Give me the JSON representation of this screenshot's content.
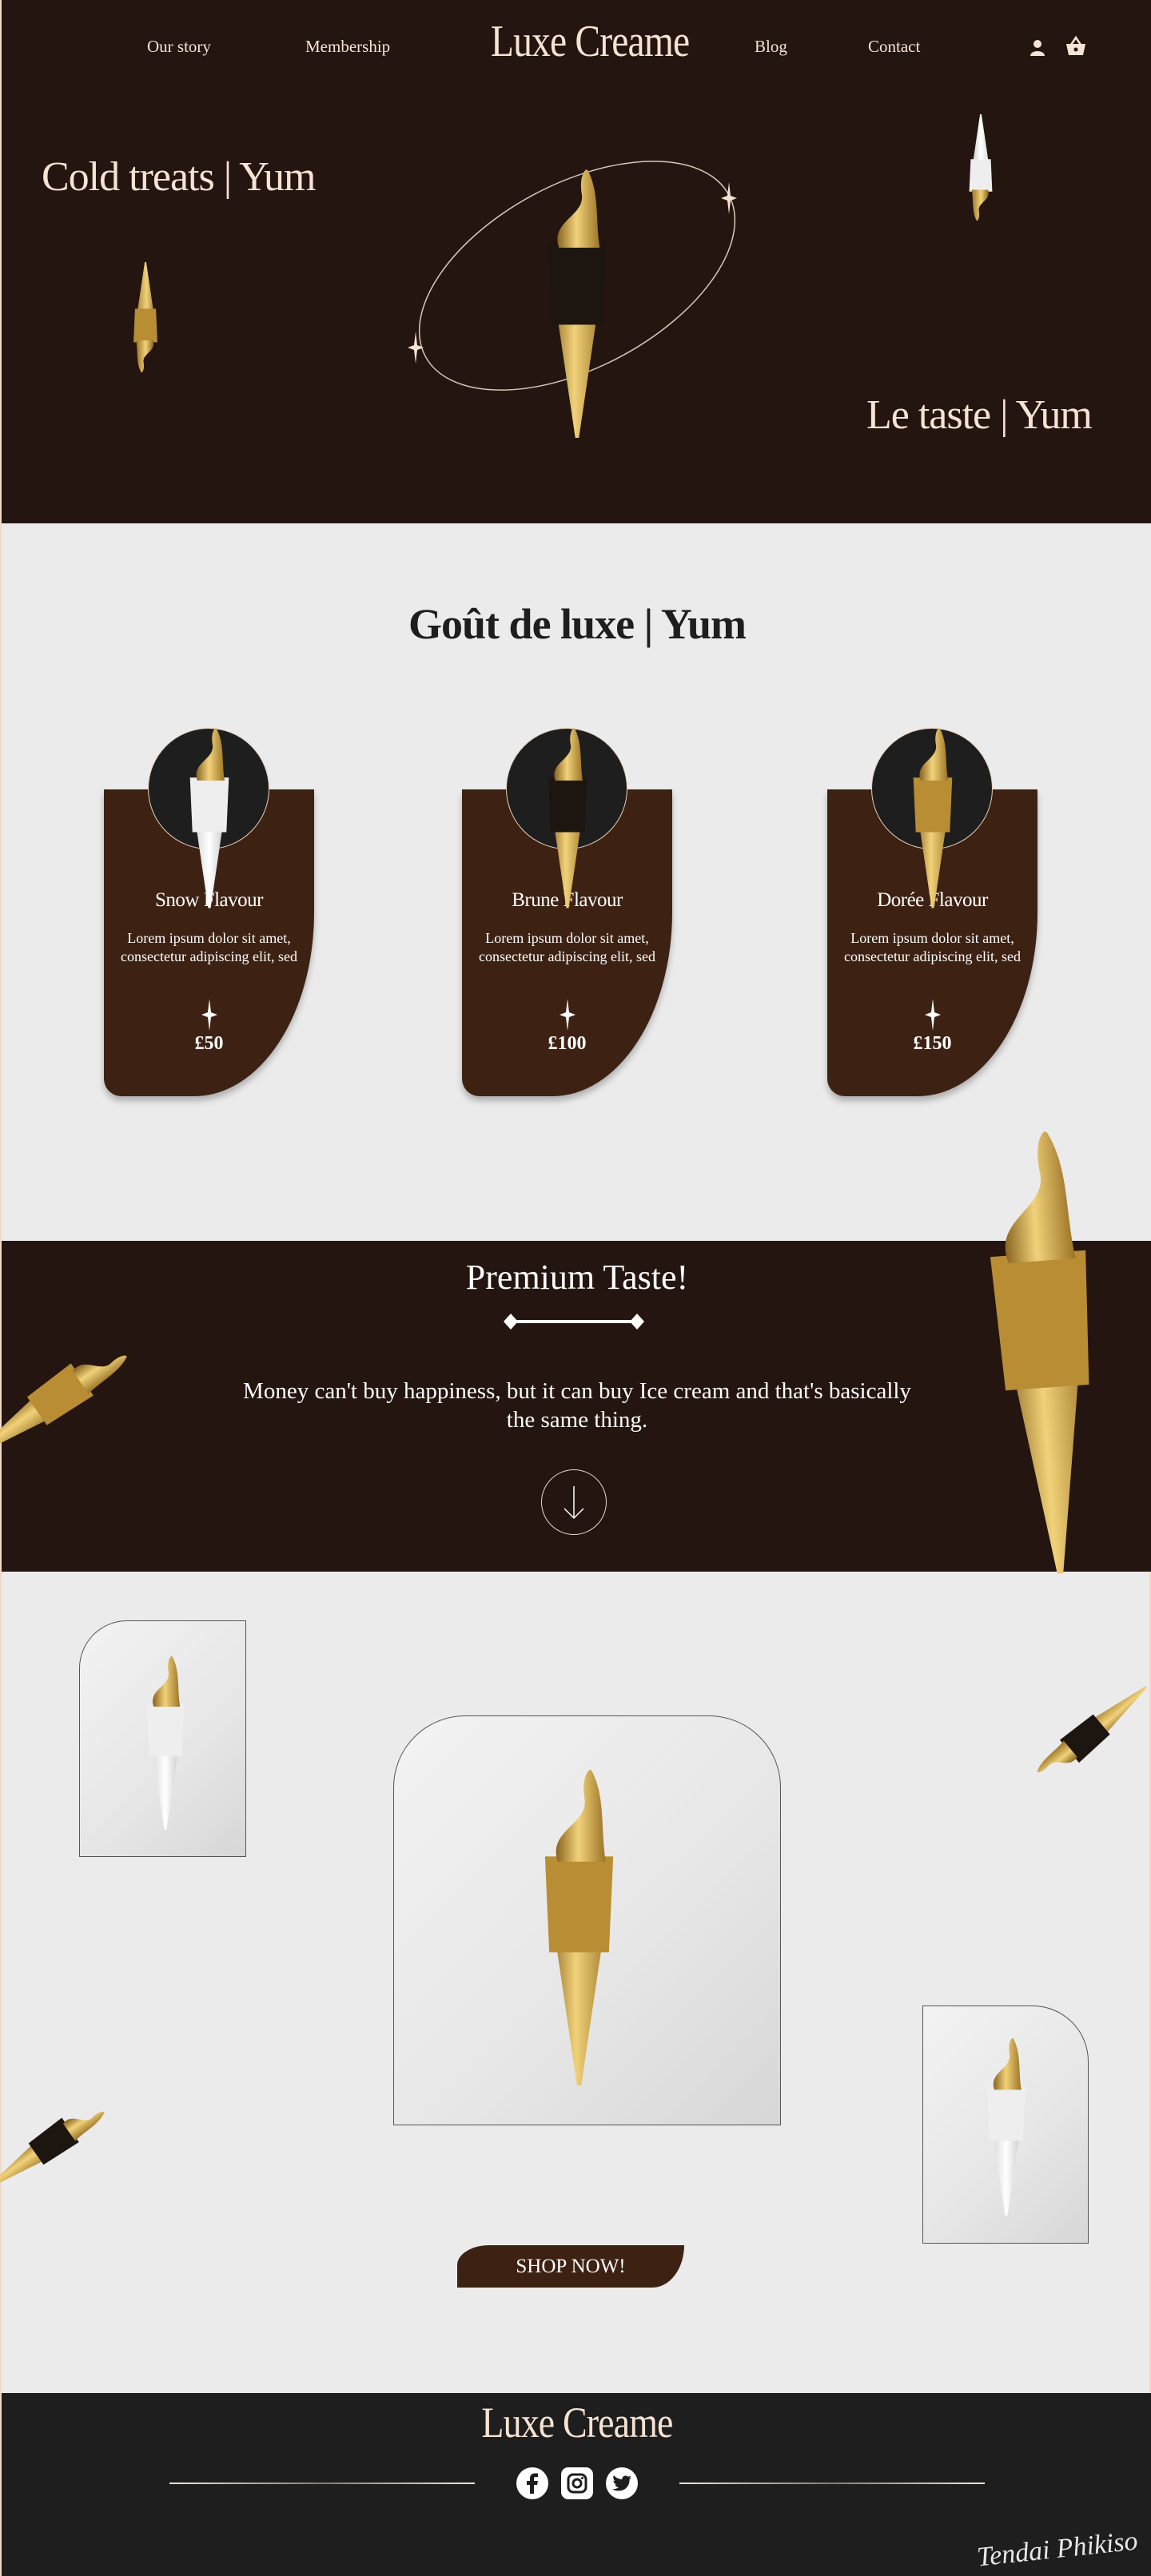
{
  "nav": {
    "items": [
      "Our story",
      "Membership",
      "Blog",
      "Contact"
    ],
    "logo": "Luxe Creame",
    "icons": [
      "user-icon",
      "basket-icon"
    ]
  },
  "hero": {
    "title_left": "Cold treats | Yum",
    "title_right": "Le taste | Yum"
  },
  "flavours": {
    "title": "Goût de luxe | Yum",
    "cards": [
      {
        "name": "Snow Flavour",
        "desc": "Lorem ipsum dolor sit amet, consectetur adipiscing elit, sed",
        "price": "£50"
      },
      {
        "name": "Brune Flavour",
        "desc": "Lorem ipsum dolor sit amet, consectetur adipiscing elit, sed",
        "price": "£100"
      },
      {
        "name": "Dorée Flavour",
        "desc": "Lorem ipsum dolor sit amet, consectetur adipiscing elit, sed",
        "price": "£150"
      }
    ]
  },
  "premium": {
    "title": "Premium Taste!",
    "quote": "Money can't buy happiness, but it can buy Ice cream and that's basically the same thing."
  },
  "gallery": {
    "cta": "SHOP NOW!"
  },
  "footer": {
    "logo": "Luxe Creame",
    "social": [
      "facebook-icon",
      "instagram-icon",
      "twitter-icon"
    ],
    "signature": "Tendai Phikiso"
  },
  "colors": {
    "dark": "#241510",
    "card": "#3d2213",
    "cream": "#f7e3d3",
    "gold": "#c9a24a",
    "footer": "#1e1e1e",
    "bg": "#ebebeb"
  }
}
